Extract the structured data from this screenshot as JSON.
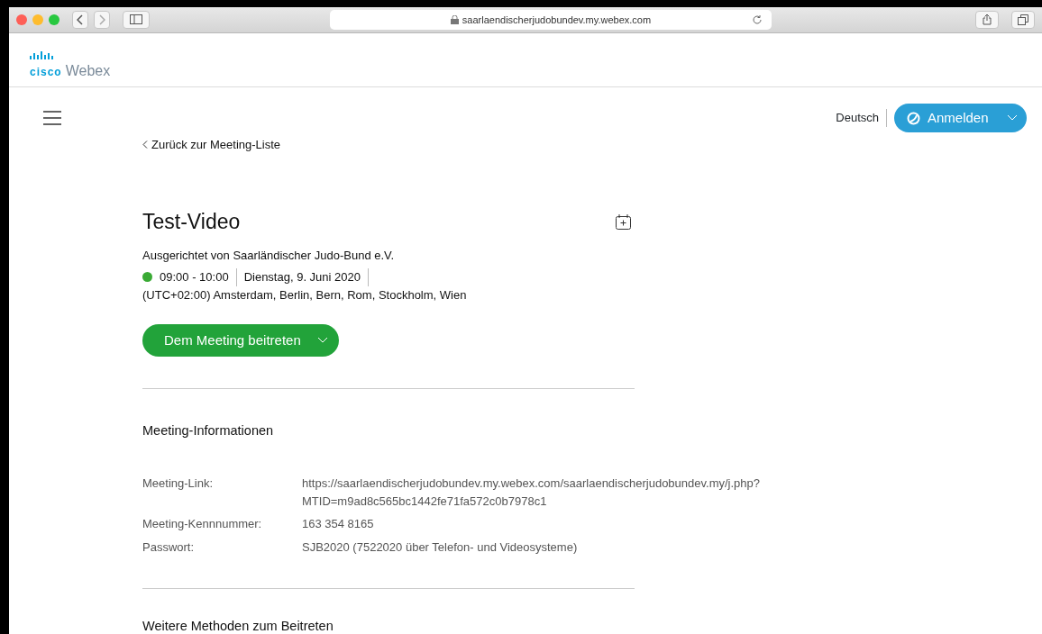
{
  "browser": {
    "url": "saarlaendischerjudobundev.my.webex.com"
  },
  "brand": {
    "logo_top": "cisco",
    "logo_name": "Webex"
  },
  "header": {
    "language": "Deutsch",
    "signin_button": "Anmelden"
  },
  "back_link": "Zurück zur Meeting-Liste",
  "meeting": {
    "title": "Test-Video",
    "host": "Ausgerichtet von Saarländischer Judo-Bund e.V.",
    "in_progress": true,
    "time": "09:00 - 10:00",
    "date": "Dienstag, 9. Juni 2020",
    "timezone": "(UTC+02:00) Amsterdam, Berlin, Bern, Rom, Stockholm, Wien",
    "join_button": "Dem Meeting beitreten"
  },
  "info": {
    "heading": "Meeting-Informationen",
    "rows": [
      {
        "label": "Meeting-Link:",
        "value": "https://saarlaendischerjudobundev.my.webex.com/saarlaendischerjudobundev.my/j.php?\nMTID=m9ad8c565bc1442fe71fa572c0b7978c1"
      },
      {
        "label": "Meeting-Kennnummer:",
        "value": "163 354 8165"
      },
      {
        "label": "Passwort:",
        "value": "SJB2020 (7522020 über Telefon- und Videosysteme)"
      }
    ]
  },
  "more_heading": "Weitere Methoden zum Beitreten"
}
